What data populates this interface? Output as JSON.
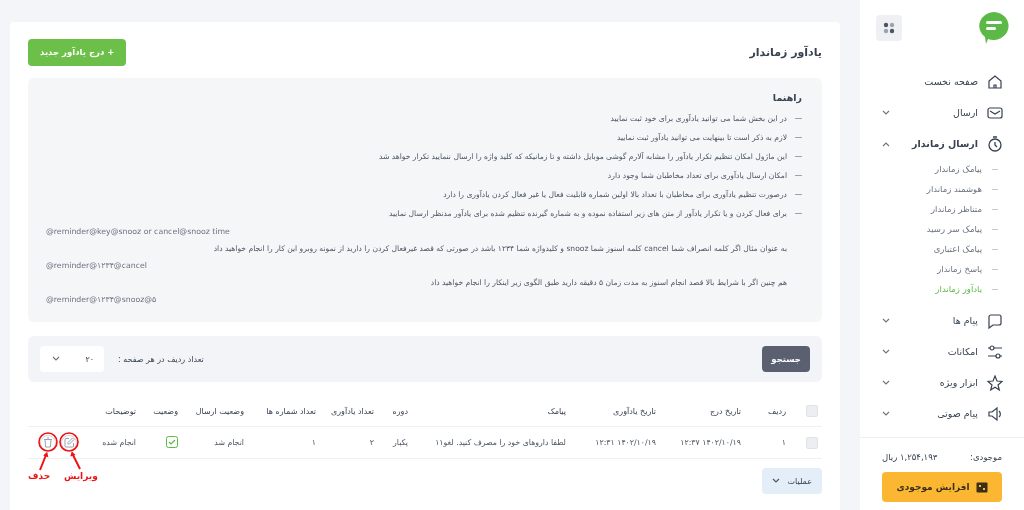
{
  "sidebar": {
    "items": [
      {
        "kind": "link",
        "label": "صفحه نخست"
      },
      {
        "kind": "group",
        "label": "ارسال",
        "expanded": false
      },
      {
        "kind": "group",
        "label": "ارسال زماندار",
        "expanded": true,
        "children": [
          {
            "label": "پیامک زماندار",
            "selected": false
          },
          {
            "label": "هوشمند زماندار",
            "selected": false
          },
          {
            "label": "متناظر زماندار",
            "selected": false
          },
          {
            "label": "پیامک سر رسید",
            "selected": false
          },
          {
            "label": "پیامک اعتباری",
            "selected": false
          },
          {
            "label": "پاسخ زماندار",
            "selected": false
          },
          {
            "label": "یادآور زماندار",
            "selected": true
          }
        ]
      },
      {
        "kind": "group",
        "label": "پیام ها",
        "expanded": false
      },
      {
        "kind": "group",
        "label": "امکانات",
        "expanded": false
      },
      {
        "kind": "group",
        "label": "ابزار ویژه",
        "expanded": false
      },
      {
        "kind": "group",
        "label": "پیام صوتی",
        "expanded": false
      }
    ],
    "balance": {
      "label": "موجودی:",
      "amount": "۱,۲۵۴,۱۹۳ ریال"
    },
    "topup_button": "افزایش موجودی"
  },
  "page": {
    "title": "یادآور زماندار",
    "add_button": "+ درج یادآور جدید"
  },
  "guide": {
    "title": "راهنما",
    "items": [
      "در این بخش شما می توانید یادآوری برای خود ثبت نمایید",
      "لازم به ذکر است تا بینهایت می توانید یادآور ثبت نمایید",
      "این ماژول امکان تنظیم تکرار یادآور را مشابه آلارم گوشی موبایل داشته و تا زمانیکه که کلید واژه را ارسال ننمایید تکرار خواهد شد",
      "امکان ارسال یادآوری برای تعداد مخاطبان شما وجود دارد",
      "درصورت تنظیم یادآوری برای مخاطبان با تعداد بالا اولین شماره قابلیت فعال یا غیر فعال کردن یادآوری را دارد",
      "برای فعال کردن و یا تکرار یادآور از متن های زیر استفاده نموده و به شماره گیرنده تنظیم شده برای یادآور مدنظر ارسال نمایید"
    ],
    "examples": [
      {
        "kind": "code",
        "text": "@reminder@key@snooz or cancel@snooz time"
      },
      {
        "kind": "text",
        "text": "به عنوان مثال اگر کلمه انصراف شما cancel کلمه اسنوز شما snooz و کلیدواژه شما ۱۲۳۴ باشد در صورتی که قصد غیرفعال کردن را دارید از نمونه روبرو این کار را انجام خواهید داد"
      },
      {
        "kind": "code",
        "text": "@reminder@۱۲۳۴@cancel"
      },
      {
        "kind": "text",
        "text": "هم چنین اگر با شرایط بالا قصد انجام اسنوز به مدت زمان ۵ دقیقه دارید طبق الگوی زیر اینکار را انجام خواهید داد"
      },
      {
        "kind": "code",
        "text": "@reminder@۱۲۳۴@snooz@۵"
      }
    ]
  },
  "filter": {
    "search_button": "جستجو",
    "rows_label": "تعداد ردیف در هر صفحه :",
    "rows_value": "۲۰"
  },
  "table": {
    "all_checked": false,
    "columns": [
      "ردیف",
      "تاریخ درج",
      "تاریخ یادآوری",
      "پیامک",
      "دوره",
      "تعداد یادآوری",
      "تعداد شماره ها",
      "وضعیت ارسال",
      "وضعیت",
      "توضیحات"
    ],
    "rows": [
      {
        "checked": false,
        "cells": [
          "۱",
          "۱۴۰۲/۱۰/۱۹ ۱۲:۳۷",
          "۱۴۰۲/۱۰/۱۹ ۱۲:۳۱",
          "لطفا داروهای خود را مصرف کنید. لغو۱۱",
          "یکبار",
          "۲",
          "۱",
          "انجام شد"
        ],
        "status": true,
        "description": "انجام شده"
      }
    ]
  },
  "operations_button": "عملیات",
  "annotations": [
    {
      "label": "ویرایش"
    },
    {
      "label": "حذف"
    }
  ]
}
